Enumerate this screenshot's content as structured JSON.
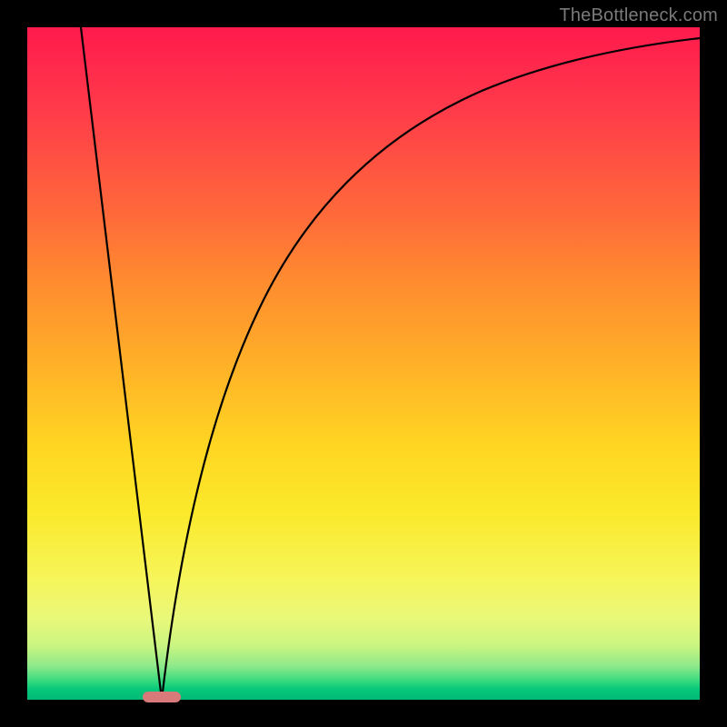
{
  "watermark": "TheBottleneck.com",
  "chart_data": {
    "type": "line",
    "title": "",
    "xlabel": "",
    "ylabel": "",
    "xlim": [
      0,
      100
    ],
    "ylim": [
      0,
      100
    ],
    "grid": false,
    "legend": false,
    "curve_points_xy": [
      [
        8,
        100
      ],
      [
        10,
        85
      ],
      [
        12,
        70
      ],
      [
        14,
        55
      ],
      [
        16,
        40
      ],
      [
        18,
        25
      ],
      [
        19,
        12
      ],
      [
        20,
        0
      ],
      [
        21,
        12
      ],
      [
        23,
        28
      ],
      [
        26,
        44
      ],
      [
        30,
        58
      ],
      [
        35,
        68
      ],
      [
        42,
        77
      ],
      [
        50,
        83
      ],
      [
        60,
        88
      ],
      [
        72,
        92
      ],
      [
        86,
        95
      ],
      [
        100,
        97
      ]
    ],
    "minimum_marker_x": 20,
    "background_gradient_stops": [
      {
        "pos": 0,
        "color": "#ff1a4d"
      },
      {
        "pos": 28,
        "color": "#ff6a3a"
      },
      {
        "pos": 50,
        "color": "#ffb028"
      },
      {
        "pos": 72,
        "color": "#fbe92a"
      },
      {
        "pos": 90,
        "color": "#c9f581"
      },
      {
        "pos": 100,
        "color": "#00b876"
      }
    ]
  }
}
